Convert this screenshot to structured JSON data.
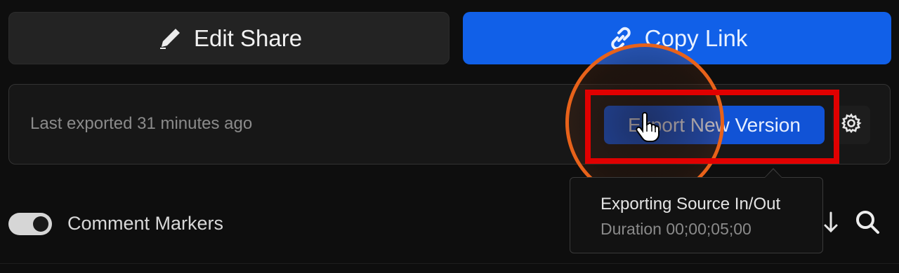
{
  "top_buttons": {
    "edit_share_label": "Edit Share",
    "edit_share_icon": "pencil-icon",
    "copy_link_label": "Copy Link",
    "copy_link_icon": "link-icon"
  },
  "export_panel": {
    "last_exported_text": "Last exported 31 minutes ago",
    "export_button_label": "Export New Version",
    "settings_icon": "gear-icon"
  },
  "tooltip": {
    "line1": "Exporting Source In/Out",
    "line2": "Duration 00;00;05;00"
  },
  "bottom_row": {
    "toggle_on": true,
    "comment_markers_label": "Comment Markers",
    "sort_icon": "arrow-down-icon",
    "search_icon": "search-icon"
  },
  "colors": {
    "background": "#0e0e0e",
    "accent_blue": "#1160e8",
    "export_button_blue": "#1153d6",
    "annotation_red": "#e10000",
    "annotation_orange": "#e8621a"
  }
}
